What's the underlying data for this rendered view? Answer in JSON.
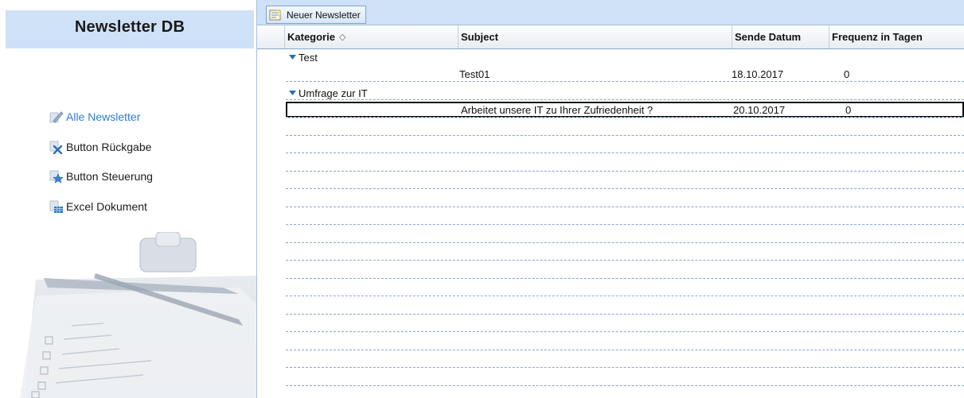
{
  "app": {
    "title": "Newsletter DB"
  },
  "sidebar": {
    "items": [
      {
        "label": "Alle Newsletter",
        "icon": "pencil-icon",
        "active": true
      },
      {
        "label": "Button Rückgabe",
        "icon": "delete-x-icon",
        "active": false
      },
      {
        "label": "Button Steuerung",
        "icon": "star-icon",
        "active": false
      },
      {
        "label": "Excel Dokument",
        "icon": "spreadsheet-icon",
        "active": false
      }
    ]
  },
  "toolbar": {
    "new_newsletter_label": "Neuer Newsletter"
  },
  "grid": {
    "columns": [
      "Kategorie",
      "Subject",
      "Sende Datum",
      "Frequenz in Tagen"
    ],
    "sort_indicator": "◇",
    "groups": [
      {
        "name": "Test",
        "rows": [
          {
            "subject": "Test01",
            "date": "18.10.2017",
            "frequency": "0"
          }
        ]
      },
      {
        "name": "Umfrage zur IT",
        "rows": [
          {
            "subject": "Arbeitet unsere IT zu Ihrer Zufriedenheit ?",
            "date": "20.10.2017",
            "frequency": "0",
            "selected": true
          }
        ]
      }
    ]
  },
  "colors": {
    "header_bg": "#cfe1f7",
    "accent": "#2e7fc7",
    "gridline": "#86a6d0"
  }
}
